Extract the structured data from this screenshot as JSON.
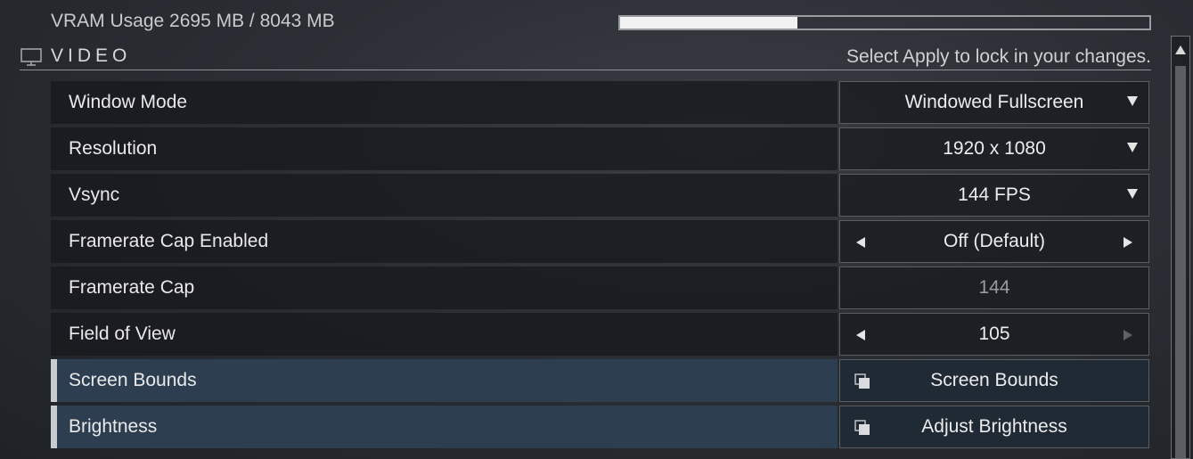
{
  "vram": {
    "label": "VRAM Usage 2695 MB / 8043 MB",
    "used_fraction": 0.335
  },
  "section": {
    "icon": "monitor-icon",
    "title": "VIDEO",
    "hint": "Select Apply to lock in your changes."
  },
  "rows": [
    {
      "label": "Window Mode",
      "control": "dropdown",
      "value": "Windowed Fullscreen"
    },
    {
      "label": "Resolution",
      "control": "dropdown",
      "value": "1920 x 1080"
    },
    {
      "label": "Vsync",
      "control": "dropdown",
      "value": "144 FPS"
    },
    {
      "label": "Framerate Cap Enabled",
      "control": "selector",
      "value": "Off (Default)"
    },
    {
      "label": "Framerate Cap",
      "control": "readonly",
      "value": "144"
    },
    {
      "label": "Field of View",
      "control": "selector",
      "value": "105"
    },
    {
      "label": "Screen Bounds",
      "control": "button",
      "value": "Screen Bounds",
      "icon": "popout-icon"
    },
    {
      "label": "Brightness",
      "control": "button",
      "value": "Adjust Brightness",
      "icon": "popout-icon"
    }
  ],
  "colors": {
    "highlight_row": "#2d3e50",
    "accent": "#c7ccd2",
    "bar_fill": "#f2f2f2"
  }
}
